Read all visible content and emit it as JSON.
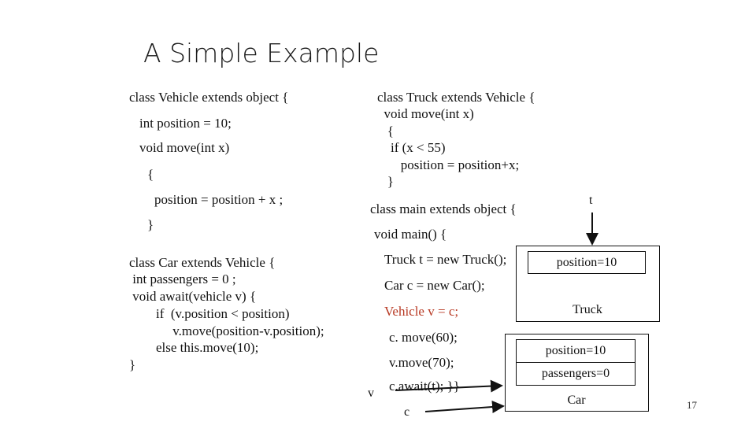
{
  "slide": {
    "title": "A Simple Example",
    "page_number": "17"
  },
  "vehicle_class": {
    "lines": [
      "class Vehicle extends object {",
      "int position = 10;",
      "void move(int x)",
      "{",
      "position = position + x ;",
      "}"
    ]
  },
  "car_class": {
    "lines": [
      "class Car extends Vehicle {",
      " int passengers = 0 ;",
      " void await(vehicle v) {",
      "        if  (v.position < position)",
      "             v.move(position-v.position);",
      "        else this.move(10);",
      "}"
    ]
  },
  "truck_class": {
    "lines": [
      "class Truck extends Vehicle {",
      "  void move(int x)",
      "   {",
      "    if (x < 55)",
      "       position = position+x;",
      "   }"
    ]
  },
  "main_class": {
    "header": "class main extends object {",
    "method": "void main() {",
    "statements": [
      "Truck t = new Truck();",
      "Car c = new Car();",
      "Vehicle v = c;",
      "c. move(60);",
      "v.move(70);",
      "c.await(t); }}"
    ],
    "highlight_color": "#b83a24"
  },
  "diagram": {
    "truck_object": {
      "reference_label": "t",
      "fields": [
        "position=10"
      ],
      "type_label": "Truck"
    },
    "car_object": {
      "reference_labels": [
        "v",
        "c"
      ],
      "fields": [
        "position=10",
        "passengers=0"
      ],
      "type_label": "Car"
    }
  }
}
